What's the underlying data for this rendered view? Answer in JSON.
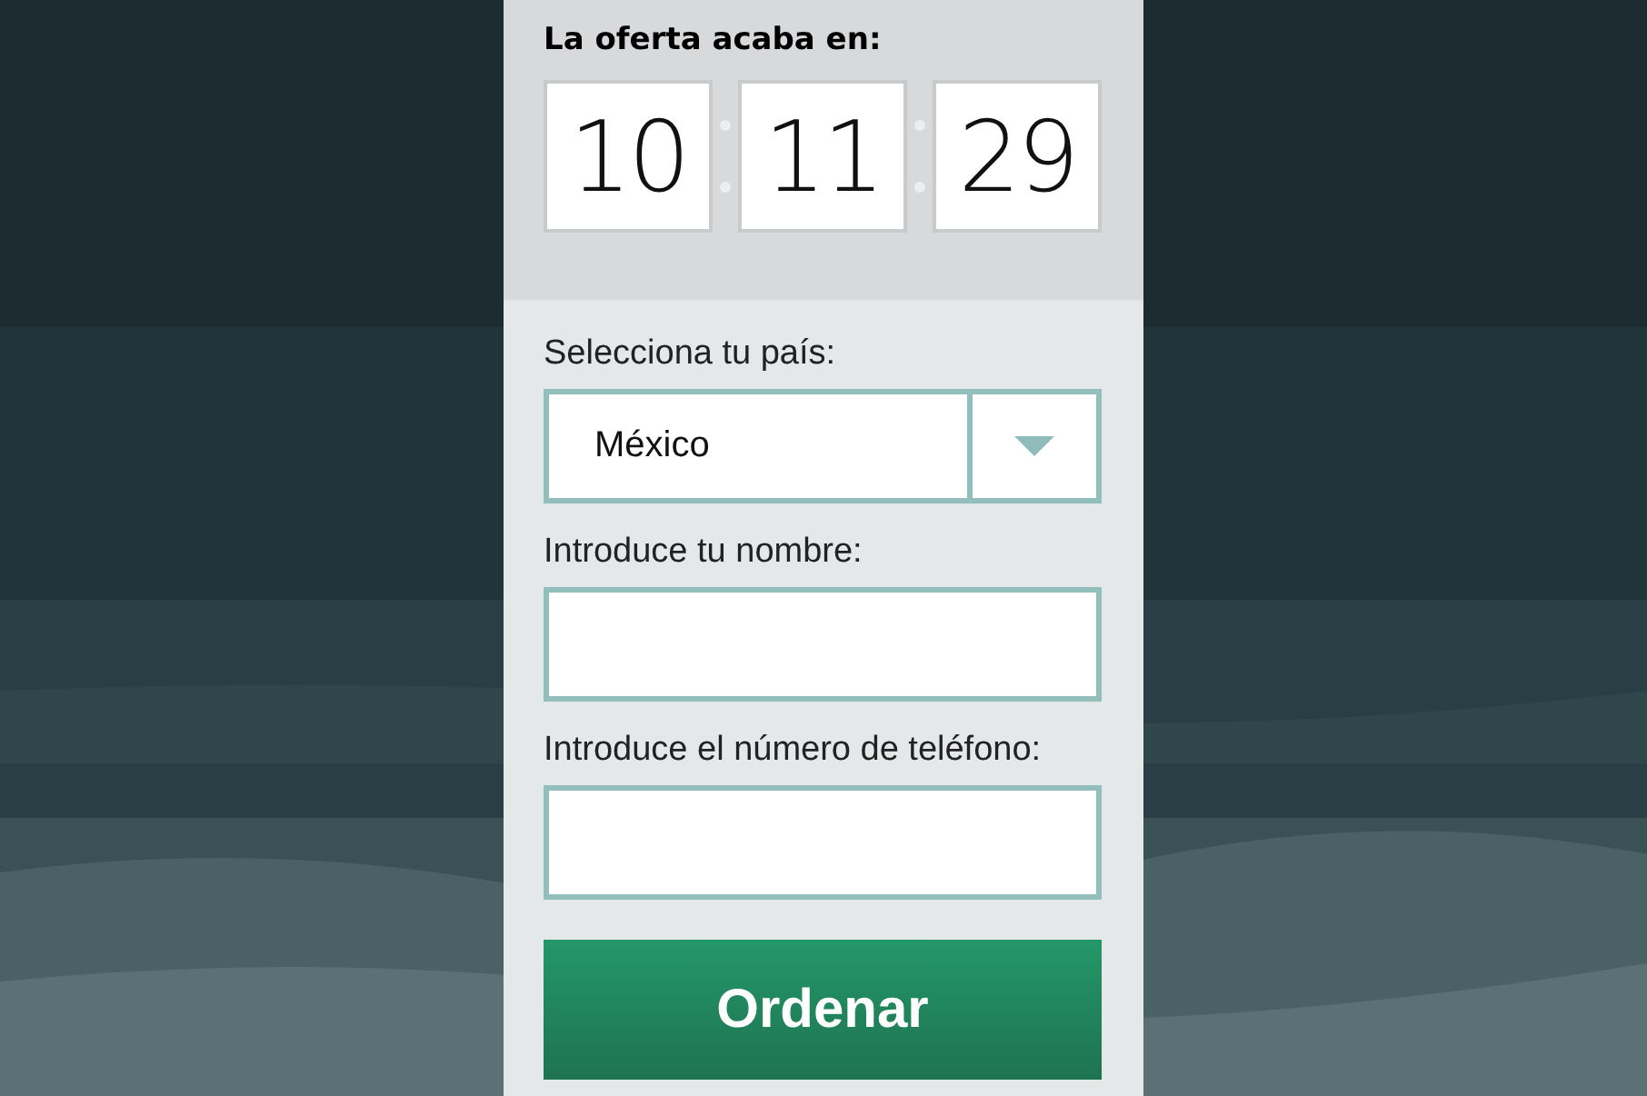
{
  "countdown": {
    "title": "La oferta acaba en:",
    "units": [
      "10",
      "11",
      "29"
    ]
  },
  "form": {
    "fields": [
      {
        "kind": "select",
        "label": "Selecciona tu país:",
        "value": "México"
      },
      {
        "kind": "text",
        "label": "Introduce tu nombre:"
      },
      {
        "kind": "text",
        "label": "Introduce el número de teléfono:"
      }
    ],
    "submit": "Ordenar"
  }
}
